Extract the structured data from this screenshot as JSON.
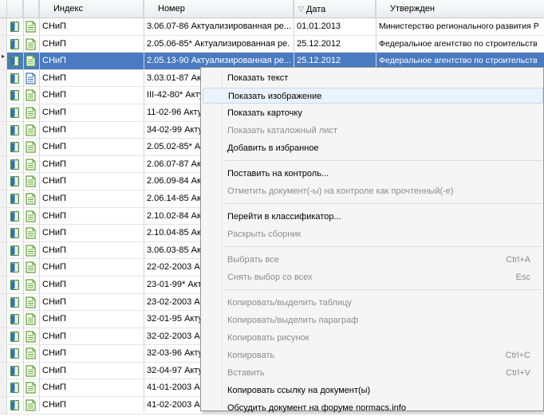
{
  "columns": {
    "index": "Индекс",
    "number": "Номер",
    "date": "Дата",
    "approved": "Утвержден"
  },
  "rows": [
    {
      "index": "СНиП",
      "number": "3.06.07-86 Актуализированная ре...",
      "date": "01.01.2013",
      "approved": "Министерство регионального развития Р"
    },
    {
      "index": "СНиП",
      "number": "2.05.06-85* Актуализированная ре...",
      "date": "25.12.2012",
      "approved": "Федеральное агентство по строительств"
    },
    {
      "index": "СНиП",
      "number": "2.05.13-90 Актуализированная ре...",
      "date": "25.12.2012",
      "approved": "Федеральное агентство по строительств"
    },
    {
      "index": "СНиП",
      "number": "3.03.01-87 Акту",
      "date": "",
      "approved": ""
    },
    {
      "index": "СНиП",
      "number": "III-42-80* Акту",
      "date": "",
      "approved": ""
    },
    {
      "index": "СНиП",
      "number": "11-02-96 Актуа",
      "date": "",
      "approved": ""
    },
    {
      "index": "СНиП",
      "number": "34-02-99 Актуа",
      "date": "",
      "approved": ""
    },
    {
      "index": "СНиП",
      "number": "2.05.02-85* Ак",
      "date": "",
      "approved": ""
    },
    {
      "index": "СНиП",
      "number": "2.06.07-87 Акту",
      "date": "",
      "approved": ""
    },
    {
      "index": "СНиП",
      "number": "2.06.09-84 Акту",
      "date": "",
      "approved": ""
    },
    {
      "index": "СНиП",
      "number": "2.06.14-85 Акту",
      "date": "",
      "approved": ""
    },
    {
      "index": "СНиП",
      "number": "2.10.02-84 Акту",
      "date": "",
      "approved": ""
    },
    {
      "index": "СНиП",
      "number": "2.10.04-85 Акту",
      "date": "",
      "approved": ""
    },
    {
      "index": "СНиП",
      "number": "3.06.03-85 Акту",
      "date": "",
      "approved": ""
    },
    {
      "index": "СНиП",
      "number": "22-02-2003 Ак",
      "date": "",
      "approved": ""
    },
    {
      "index": "СНиП",
      "number": "23-01-99* Акт",
      "date": "",
      "approved": ""
    },
    {
      "index": "СНиП",
      "number": "23-02-2003 Ак",
      "date": "",
      "approved": ""
    },
    {
      "index": "СНиП",
      "number": "32-01-95 Акту",
      "date": "",
      "approved": ""
    },
    {
      "index": "СНиП",
      "number": "32-02-2003 Ак",
      "date": "",
      "approved": ""
    },
    {
      "index": "СНиП",
      "number": "32-03-96 Акту",
      "date": "",
      "approved": ""
    },
    {
      "index": "СНиП",
      "number": "32-04-97 Акту",
      "date": "",
      "approved": ""
    },
    {
      "index": "СНиП",
      "number": "41-01-2003 Ак",
      "date": "",
      "approved": ""
    },
    {
      "index": "СНиП",
      "number": "41-02-2003 Ак",
      "date": "",
      "approved": ""
    }
  ],
  "selected_row": 2,
  "menu": [
    {
      "label": "Показать текст",
      "disabled": false
    },
    {
      "label": "Показать изображение",
      "disabled": false,
      "hover": true
    },
    {
      "label": "Показать карточку",
      "disabled": false
    },
    {
      "label": "Показать каталожный лист",
      "disabled": true
    },
    {
      "label": "Добавить в избранное",
      "disabled": false
    },
    {
      "sep": true
    },
    {
      "label": "Поставить на контроль...",
      "disabled": false
    },
    {
      "label": "Отметить документ(-ы) на контроле как прочтенный(-е)",
      "disabled": true
    },
    {
      "sep": true
    },
    {
      "label": "Перейти в классификатор...",
      "disabled": false
    },
    {
      "label": "Раскрыть сборник",
      "disabled": true
    },
    {
      "sep": true
    },
    {
      "label": "Выбрать все",
      "disabled": true,
      "shortcut": "Ctrl+A"
    },
    {
      "label": "Снять выбор со всех",
      "disabled": true,
      "shortcut": "Esc"
    },
    {
      "sep": true
    },
    {
      "label": "Копировать/выделить таблицу",
      "disabled": true
    },
    {
      "label": "Копировать/выделить параграф",
      "disabled": true
    },
    {
      "label": "Копировать рисунок",
      "disabled": true
    },
    {
      "label": "Копировать",
      "disabled": true,
      "shortcut": "Ctrl+C"
    },
    {
      "label": "Вставить",
      "disabled": true,
      "shortcut": "Ctrl+V"
    },
    {
      "label": "Копировать ссылку на документ(ы)",
      "disabled": false
    },
    {
      "label": "Обсудить документ на форуме normacs.info",
      "disabled": false
    }
  ],
  "colors": {
    "selection": "#4a7bc1",
    "menu_bg": "#f5f5f5",
    "book_icon": "#3a8f2e",
    "doc_icon": "#5aa02c"
  },
  "icons": {
    "row_book": "book-icon",
    "row_doc": "document-icon",
    "row_doc_alt": "blue-document-icon",
    "sort": "sort-descending-icon",
    "row_pointer": "row-pointer-icon"
  }
}
